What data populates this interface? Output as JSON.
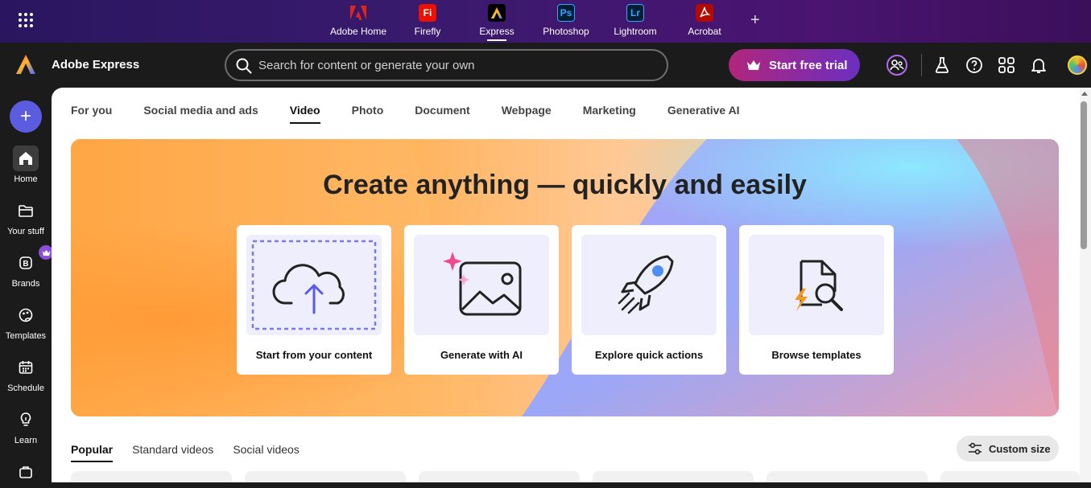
{
  "app_switcher": {
    "apps": [
      {
        "label": "Adobe Home",
        "glyph": "A",
        "color": "#e1251b",
        "bg": "transparent"
      },
      {
        "label": "Firefly",
        "glyph": "Fi",
        "color": "#ffffff",
        "bg": "#eb1000"
      },
      {
        "label": "Express",
        "glyph": "A",
        "color": "#ffffff",
        "bg": "#000000",
        "active": true
      },
      {
        "label": "Photoshop",
        "glyph": "Ps",
        "color": "#31a8ff",
        "bg": "#001e36"
      },
      {
        "label": "Lightroom",
        "glyph": "Lr",
        "color": "#31a8ff",
        "bg": "#001e36"
      },
      {
        "label": "Acrobat",
        "glyph": "A",
        "color": "#ffffff",
        "bg": "#b30b00"
      }
    ],
    "add_glyph": "+"
  },
  "header": {
    "brand_name": "Adobe Express",
    "search_placeholder": "Search for content or generate your own",
    "trial_label": "Start free trial"
  },
  "rail": {
    "create_glyph": "+",
    "items": [
      {
        "label": "Home",
        "icon": "home-icon",
        "active": true
      },
      {
        "label": "Your stuff",
        "icon": "folder-icon"
      },
      {
        "label": "Brands",
        "icon": "brand-icon"
      },
      {
        "label": "Templates",
        "icon": "templates-icon"
      },
      {
        "label": "Schedule",
        "icon": "calendar-icon"
      },
      {
        "label": "Learn",
        "icon": "lightbulb-icon"
      }
    ]
  },
  "tabs": [
    {
      "label": "For you"
    },
    {
      "label": "Social media and ads"
    },
    {
      "label": "Video",
      "active": true
    },
    {
      "label": "Photo"
    },
    {
      "label": "Document"
    },
    {
      "label": "Webpage"
    },
    {
      "label": "Marketing"
    },
    {
      "label": "Generative AI"
    }
  ],
  "hero": {
    "title": "Create anything — quickly and easily",
    "cards": [
      {
        "label": "Start from your content",
        "icon": "cloud-upload-icon"
      },
      {
        "label": "Generate with AI",
        "icon": "ai-image-icon"
      },
      {
        "label": "Explore quick actions",
        "icon": "rocket-icon"
      },
      {
        "label": "Browse templates",
        "icon": "template-search-icon"
      }
    ]
  },
  "subtabs": [
    {
      "label": "Popular",
      "active": true
    },
    {
      "label": "Standard videos"
    },
    {
      "label": "Social videos"
    }
  ],
  "custom_size_label": "Custom size",
  "colors": {
    "accent": "#5c5ce0",
    "trial_start": "#b1267c",
    "trial_end": "#6b2fbf"
  }
}
